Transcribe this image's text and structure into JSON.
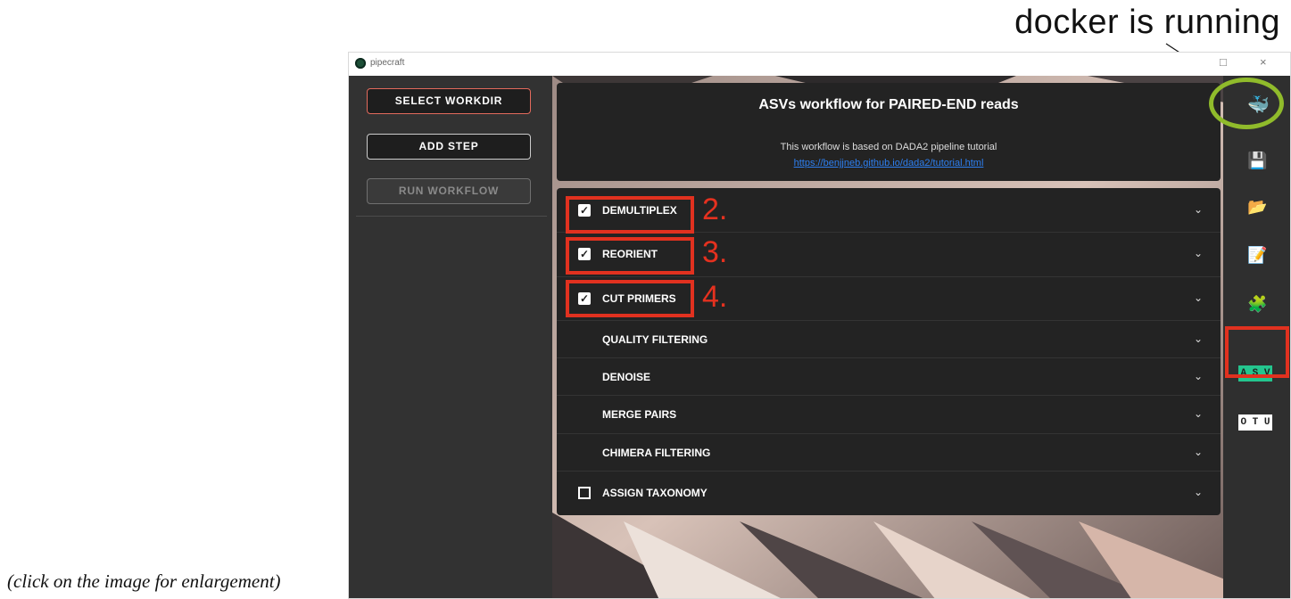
{
  "annotation": {
    "title": "docker is running",
    "caption": "(click on the image for enlargement)"
  },
  "window": {
    "title": "pipecraft",
    "controls": [
      "□",
      "×"
    ]
  },
  "sidebar": {
    "select_workdir": "SELECT WORKDIR",
    "add_step": "ADD STEP",
    "run_workflow": "RUN WORKFLOW"
  },
  "header": {
    "title": "ASVs workflow for PAIRED-END reads",
    "subtitle": "This workflow is based on DADA2 pipeline tutorial",
    "link": "https://benjjneb.github.io/dada2/tutorial.html"
  },
  "steps": [
    {
      "label": "DEMULTIPLEX",
      "checkbox": "checked",
      "number": "2."
    },
    {
      "label": "REORIENT",
      "checkbox": "checked",
      "number": "3."
    },
    {
      "label": "CUT PRIMERS",
      "checkbox": "checked",
      "number": "4."
    },
    {
      "label": "QUALITY FILTERING",
      "checkbox": "none"
    },
    {
      "label": "DENOISE",
      "checkbox": "none"
    },
    {
      "label": "MERGE PAIRS",
      "checkbox": "none"
    },
    {
      "label": "CHIMERA FILTERING",
      "checkbox": "none"
    },
    {
      "label": "ASSIGN TAXONOMY",
      "checkbox": "unchecked"
    }
  ],
  "right_panel": {
    "icons": [
      "docker-icon",
      "save-icon",
      "folder-open-icon",
      "checklist-icon",
      "puzzle-icon"
    ],
    "asv_label": "A S V",
    "otu_label": "O T U",
    "asv_color": "#24c58e"
  },
  "colors": {
    "annotation_red": "#e1311f",
    "docker_green": "#24c58e",
    "oval_green": "#90bb2b"
  }
}
